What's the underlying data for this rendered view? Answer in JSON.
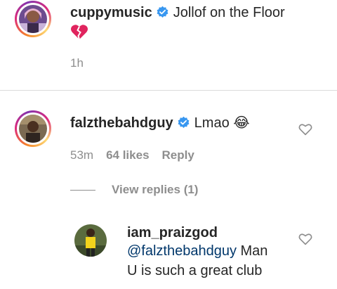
{
  "comments": [
    {
      "username": "cuppymusic",
      "verified": true,
      "text": "Jollof on the Floor",
      "emoji": "💔",
      "time": "1h"
    },
    {
      "username": "falzthebahdguy",
      "verified": true,
      "text": "Lmao 😂",
      "time": "53m",
      "likes": "64 likes",
      "reply_label": "Reply",
      "view_replies": "View replies (1)",
      "replies": [
        {
          "username": "iam_praizgod",
          "mention": "@falzthebahdguy",
          "text_line1": " Man",
          "text_line2": "U is such a great club"
        }
      ]
    }
  ],
  "icons": [
    "verified-badge-icon",
    "heart-outline-icon",
    "broken-heart-emoji"
  ],
  "colors": {
    "verified": "#3897f0",
    "muted": "#8e8e8e",
    "mention": "#00376b",
    "broken_heart": "#e0245e"
  }
}
